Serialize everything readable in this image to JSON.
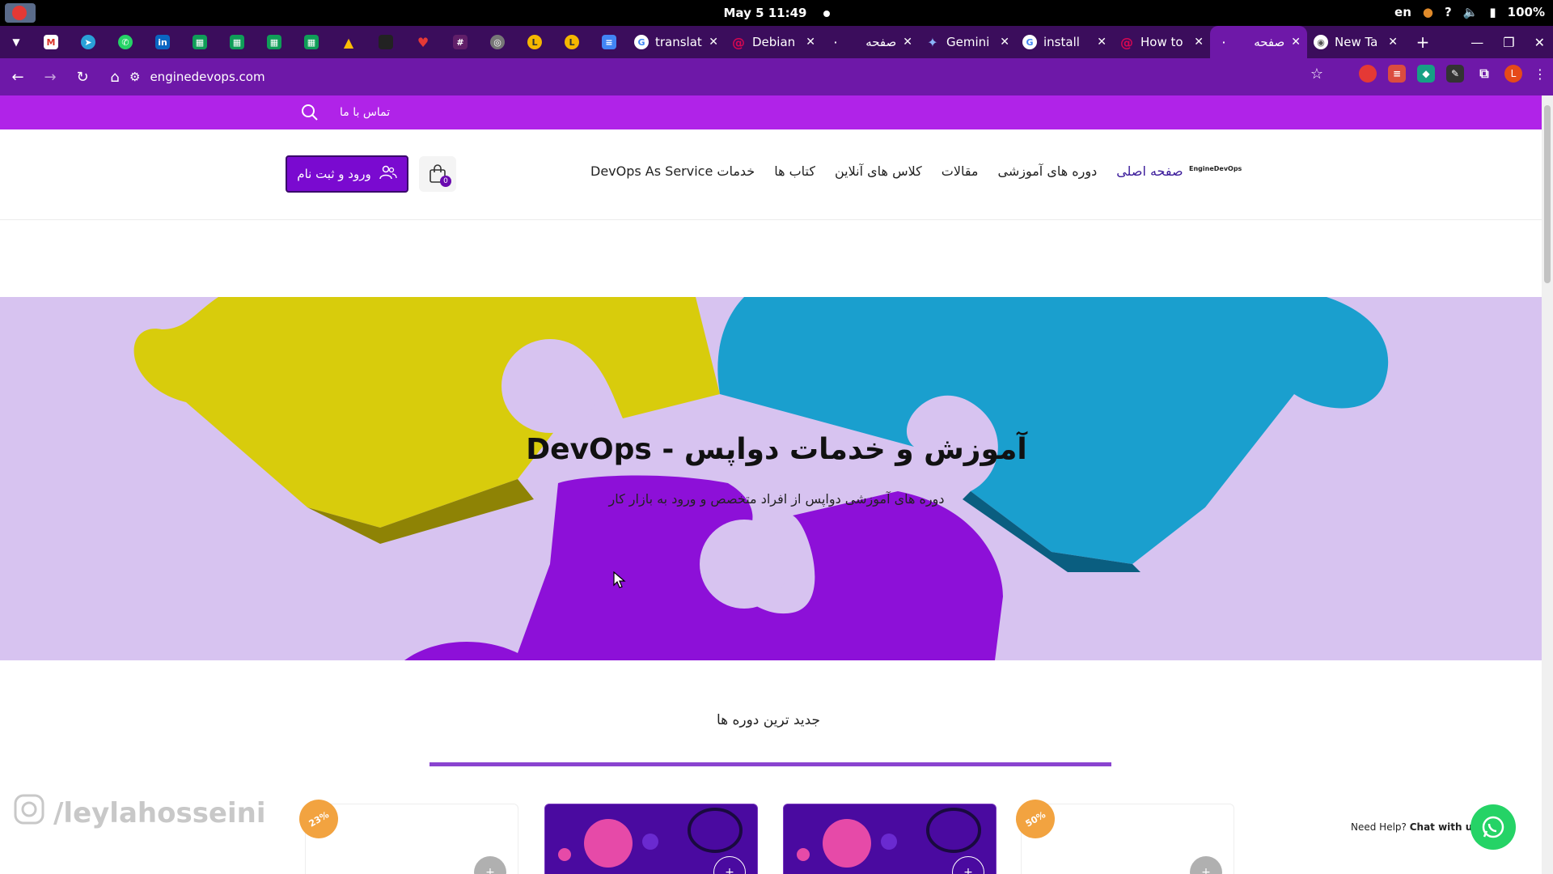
{
  "os": {
    "clock": "May 5  11:49",
    "lang": "en",
    "battery": "100%"
  },
  "tabs": [
    {
      "title": "translat",
      "icon": "google-icon"
    },
    {
      "title": "Debian",
      "icon": "debian-icon"
    },
    {
      "title": "صفحه",
      "icon": "site-icon"
    },
    {
      "title": "Gemini",
      "icon": "gemini-icon"
    },
    {
      "title": "install",
      "icon": "google-icon"
    },
    {
      "title": "How to",
      "icon": "debian-icon"
    },
    {
      "title": "صفحه",
      "icon": "site-icon",
      "active": true
    },
    {
      "title": "New Ta",
      "icon": "chrome-icon"
    }
  ],
  "address_bar": {
    "url": "enginedevops.com"
  },
  "site": {
    "contact_us": "تماس با ما",
    "login_label": "ورود و ثبت نام",
    "cart_count": "0",
    "logo_text": "EngineDevOps",
    "nav": [
      "صفحه اصلی",
      "دوره های آموزشی",
      "مقالات",
      "کلاس های آنلاین",
      "کتاب ها",
      "خدمات DevOps As Service"
    ],
    "hero_title": "آموزش و خدمات دواپس - DevOps",
    "hero_subtitle": "دوره های آموزشی دواپس از افراد متخصص و ورود به بازار کار",
    "courses_title": "جدید ترین دوره ها",
    "badges": [
      "23%",
      "50%"
    ],
    "help_text": "Need Help?",
    "help_link": "Chat with us"
  },
  "watermark": "/leylahosseini",
  "colors": {
    "brand_purple": "#b023e8",
    "tab_strip": "#3b0d5c",
    "toolbar": "#6e18a8",
    "button": "#7a0ad0",
    "hero_bg": "#d7c3f0",
    "whatsapp": "#25d366"
  }
}
